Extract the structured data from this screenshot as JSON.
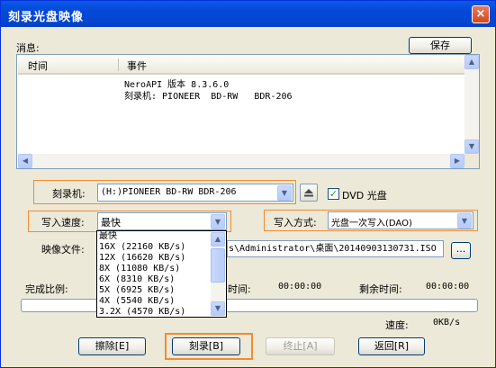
{
  "window": {
    "title": "刻录光盘映像",
    "close_glyph": "×"
  },
  "messages": {
    "label": "消息:",
    "save_button": "保存",
    "columns": [
      "时间",
      "事件"
    ],
    "rows": [
      "NeroAPI 版本 8.3.6.0",
      "刻录机: PIONEER  BD-RW   BDR-206"
    ]
  },
  "recorder": {
    "label": "刻录机:",
    "value": "(H:)PIONEER  BD-RW   BDR-206",
    "dvd_checkbox_label": "DVD 光盘",
    "dvd_checked": true
  },
  "write_speed": {
    "label": "写入速度:",
    "value": "最快"
  },
  "write_mode": {
    "label": "写入方式:",
    "value": "光盘一次写入(DAO)"
  },
  "image_file": {
    "label": "映像文件:",
    "value": "s\\Administrator\\桌面\\20140903130731.ISO",
    "browse_button": "..."
  },
  "speed_options": [
    "最快",
    "16X  (22160 KB/s)",
    "12X  (16620 KB/s)",
    "8X  (11080 KB/s)",
    "6X  (8310 KB/s)",
    "5X  (6925 KB/s)",
    "4X  (5540 KB/s)",
    "3.2X  (4570 KB/s)"
  ],
  "progress": {
    "percent_label": "完成比例:",
    "elapsed_label": "时间:",
    "elapsed_value": "00:00:00",
    "remaining_label": "剩余时间:",
    "remaining_value": "00:00:00",
    "speed_label": "速度:",
    "speed_value": "0KB/s",
    "fraction": 0
  },
  "buttons": {
    "erase": "擦除[E]",
    "burn": "刻录[B]",
    "stop": "终止[A]",
    "back": "返回[R]"
  }
}
